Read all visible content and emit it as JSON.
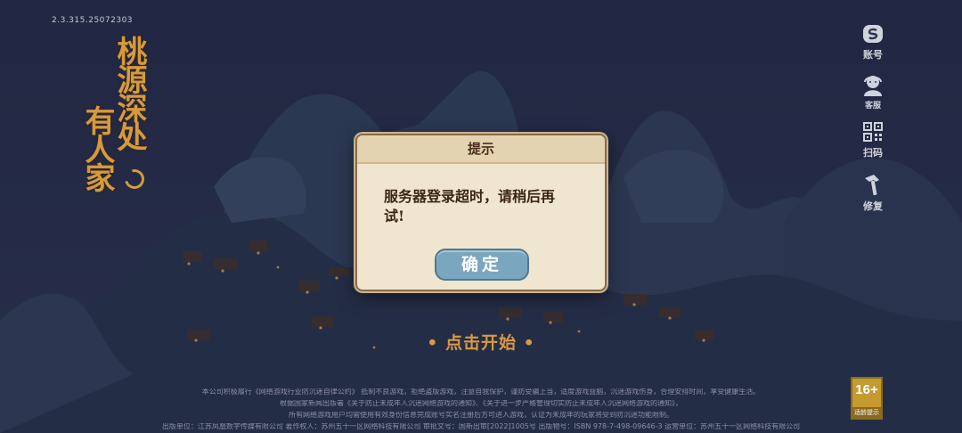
{
  "version": "2.3.315.25072303",
  "logo": {
    "line1": "桃源深处",
    "line2": "有人家"
  },
  "side_menu": [
    {
      "label": "账号",
      "icon": "account-icon"
    },
    {
      "label": "客服",
      "icon": "customer-service-icon"
    },
    {
      "label": "扫码",
      "icon": "qr-scan-icon"
    },
    {
      "label": "修复",
      "icon": "repair-hammer-icon"
    }
  ],
  "start_text": "• 点击开始 •",
  "dialog": {
    "title": "提示",
    "message_line1": "服务器登录超时，请稍后再",
    "message_line2": "试!",
    "confirm_label": "确定"
  },
  "age_rating": {
    "value": "16+",
    "label": "适龄提示"
  },
  "footer": {
    "line1": "本公司积极履行《网络游戏行业防沉迷自律公约》 抵制不良游戏，拒绝盗版游戏，注意自我保护，谨防受骗上当，适度游戏益脑，沉迷游戏伤身，合理安排时间，享受健康生活。",
    "line2": "根据国家新闻出版署《关于防止未成年人沉迷网络游戏的通知》、《关于进一步严格管理切实防止未成年人沉迷网络游戏的通知》，",
    "line3": "所有网络游戏用户均需使用有效身份信息完成账号实名注册后方可进入游戏，认证为未成年的玩家将受到防沉迷功能限制。",
    "line4": "出版单位：江苏凤凰数字传媒有限公司    著作权人：苏州五十一区网络科技有限公司    审批文号：国新出审[2022]1005号    出版物号：ISBN 978-7-498-09646-3    运营单位：苏州五十一区网络科技有限公司"
  },
  "colors": {
    "accent_orange": "#d69a3c",
    "dialog_bg": "#f0e6cf",
    "button_blue": "#7aa6c0",
    "background": "#2e3552"
  }
}
